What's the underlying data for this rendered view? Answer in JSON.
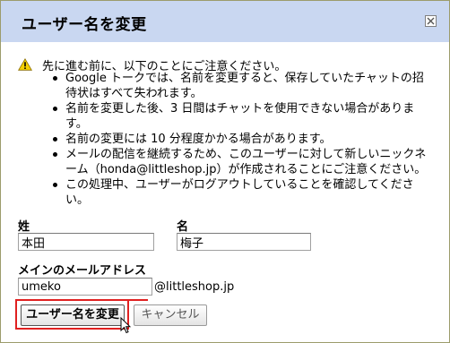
{
  "dialog": {
    "title": "ユーザー名を変更",
    "close_icon": "close-icon"
  },
  "warning": {
    "icon": "warning-icon",
    "heading": "先に進む前に、以下のことにご注意ください。",
    "bullets": [
      "Google トークでは、名前を変更すると、保存していたチャットの招待状はすべて失われます。",
      "名前を変更した後、3 日間はチャットを使用できない場合があります。",
      "名前の変更には 10 分程度かかる場合があります。",
      "メールの配信を継続するため、このユーザーに対して新しいニックネーム（honda@littleshop.jp）が作成されることにご注意ください。",
      "この処理中、ユーザーがログアウトしていることを確認してください。"
    ]
  },
  "form": {
    "last_name_label": "姓",
    "last_name_value": "本田",
    "first_name_label": "名",
    "first_name_value": "梅子",
    "email_label": "メインのメールアドレス",
    "email_value": "umeko",
    "email_domain": "@littleshop.jp"
  },
  "buttons": {
    "submit_label": "ユーザー名を変更",
    "cancel_label": "キャンセル"
  },
  "colors": {
    "titlebar": "#c9d7f1",
    "highlight": "#e02020"
  }
}
